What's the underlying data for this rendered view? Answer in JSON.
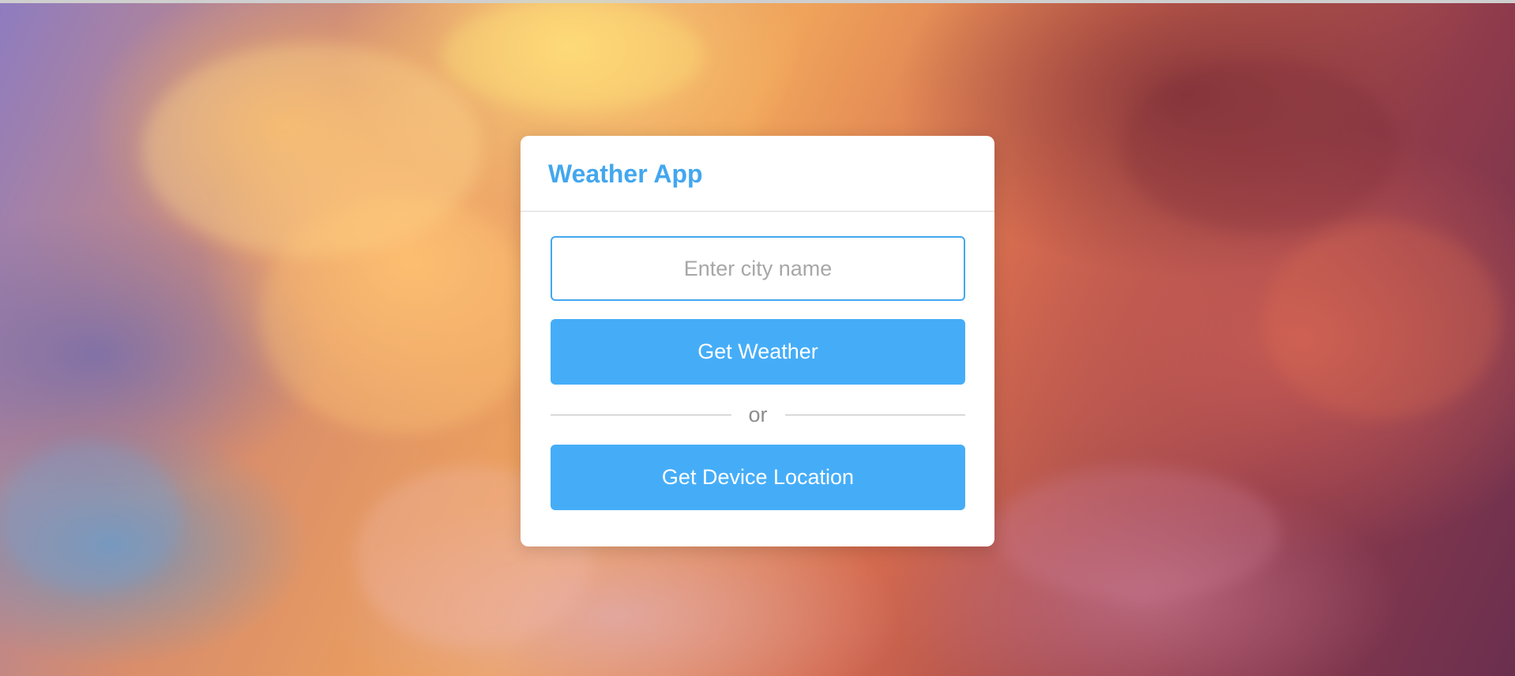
{
  "app": {
    "title": "Weather App"
  },
  "form": {
    "city_placeholder": "Enter city name",
    "city_value": "",
    "get_weather_label": "Get Weather",
    "divider_text": "or",
    "device_location_label": "Get Device Location"
  },
  "colors": {
    "accent": "#45ADF8",
    "title": "#43A7EF",
    "card_background": "#FFFFFF"
  }
}
